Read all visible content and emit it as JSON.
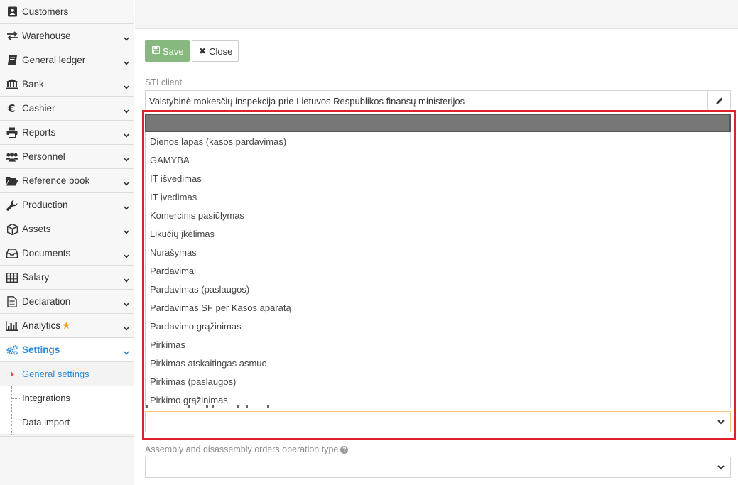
{
  "sidebar": {
    "items": [
      {
        "label": "Customers",
        "icon": "contact-book-icon",
        "expandable": false
      },
      {
        "label": "Warehouse",
        "icon": "arrows-exchange-icon",
        "expandable": true
      },
      {
        "label": "General ledger",
        "icon": "book-icon",
        "expandable": true
      },
      {
        "label": "Bank",
        "icon": "bank-icon",
        "expandable": true
      },
      {
        "label": "Cashier",
        "icon": "euro-icon",
        "expandable": true
      },
      {
        "label": "Reports",
        "icon": "printer-icon",
        "expandable": true
      },
      {
        "label": "Personnel",
        "icon": "users-icon",
        "expandable": true
      },
      {
        "label": "Reference book",
        "icon": "folder-open-icon",
        "expandable": true
      },
      {
        "label": "Production",
        "icon": "wrench-icon",
        "expandable": true
      },
      {
        "label": "Assets",
        "icon": "cube-icon",
        "expandable": true
      },
      {
        "label": "Documents",
        "icon": "inbox-icon",
        "expandable": true
      },
      {
        "label": "Salary",
        "icon": "table-icon",
        "expandable": true
      },
      {
        "label": "Declaration",
        "icon": "file-text-icon",
        "expandable": true
      },
      {
        "label": "Analytics",
        "icon": "bar-chart-icon",
        "expandable": true
      },
      {
        "label": "Settings",
        "icon": "gears-icon",
        "expandable": true
      }
    ],
    "settings_sub": [
      {
        "label": "General settings"
      },
      {
        "label": "Integrations"
      },
      {
        "label": "Data import"
      }
    ]
  },
  "toolbar": {
    "save_label": "Save",
    "close_label": "Close"
  },
  "sti_client": {
    "label": "STI client",
    "value": "Valstybinė mokesčių inspekcija prie Lietuvos Respublikos finansų ministerijos"
  },
  "dropdown": {
    "search_value": "",
    "options": [
      "Dienos lapas (kasos pardavimas)",
      "GAMYBA",
      "IT išvedimas",
      "IT įvedimas",
      "Komercinis pasiūlymas",
      "Likučių įkėlimas",
      "Nurašymas",
      "Pardavimai",
      "Pardavimas (paslaugos)",
      "Pardavimas SF per Kasos aparatą",
      "Pardavimo grąžinimas",
      "Pirkimas",
      "Pirkimas atskaitingas asmuo",
      "Pirkimas (paslaugos)",
      "Pirkimo grąžinimas"
    ]
  },
  "assembly": {
    "label": "Assembly and disassembly orders operation type",
    "help": "?"
  },
  "colors": {
    "accent": "#2e8ad8",
    "save": "#87b87f",
    "highlight": "#e0202a",
    "star": "#f39c12"
  }
}
